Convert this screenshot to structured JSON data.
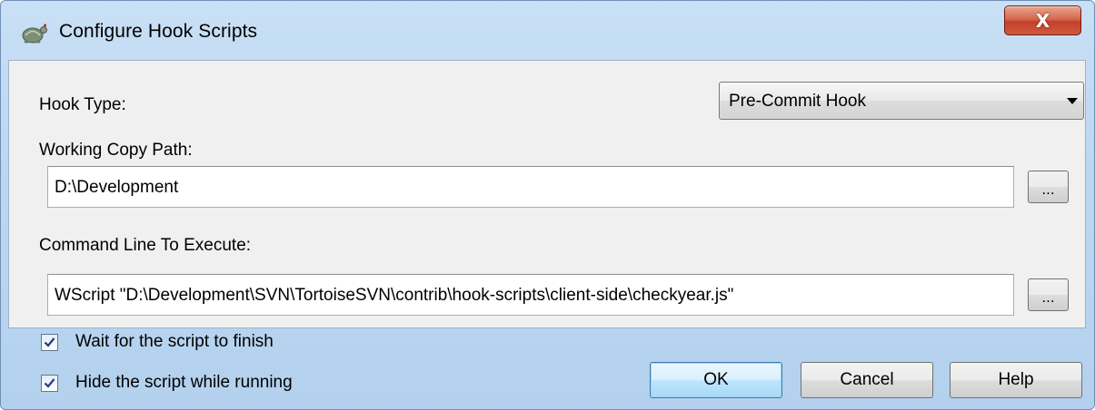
{
  "window": {
    "title": "Configure Hook Scripts",
    "close_label": "X",
    "title_icon": "tortoise-icon"
  },
  "form": {
    "hook_type_label": "Hook Type:",
    "hook_type_value": "Pre-Commit Hook",
    "working_copy_label": "Working Copy Path:",
    "working_copy_value": "D:\\Development",
    "command_label": "Command Line To Execute:",
    "command_value": "WScript \"D:\\Development\\SVN\\TortoiseSVN\\contrib\\hook-scripts\\client-side\\checkyear.js\"",
    "browse_label": "..."
  },
  "options": {
    "wait_label": "Wait for the script to finish",
    "wait_checked": true,
    "hide_label": "Hide the script while running",
    "hide_checked": true
  },
  "buttons": {
    "ok": "OK",
    "cancel": "Cancel",
    "help": "Help"
  }
}
